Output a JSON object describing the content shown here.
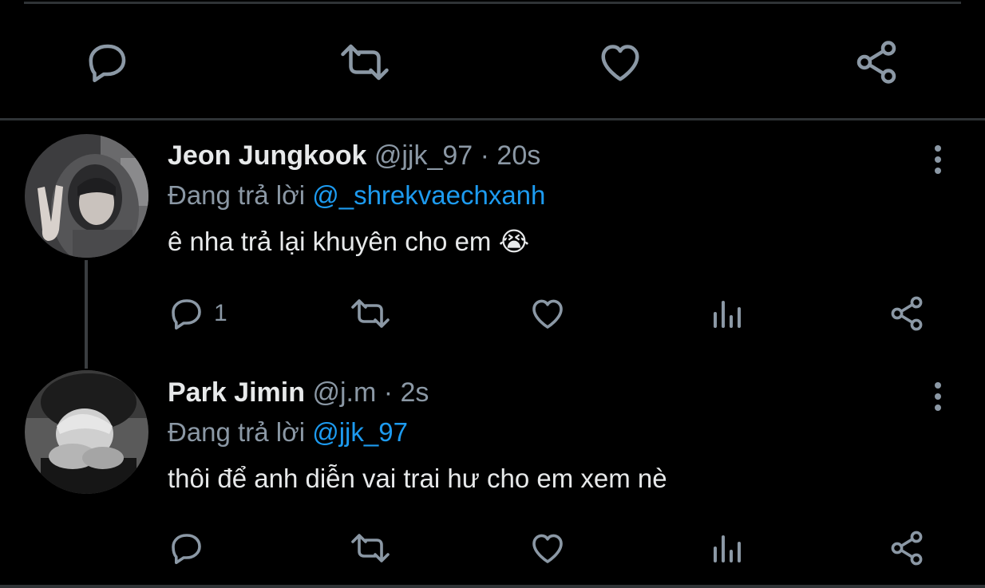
{
  "top_actions": {
    "reply_icon": "reply-icon",
    "retweet_icon": "retweet-icon",
    "like_icon": "like-icon",
    "share_icon": "share-icon"
  },
  "tweets": [
    {
      "name": "Jeon Jungkook",
      "handle": "@jjk_97",
      "separator": "·",
      "time": "20s",
      "replying_prefix": "Đang trả lời",
      "replying_to": "@_shrekvaechxanh",
      "text": "ê nha trả lại khuyên cho em 😭",
      "reply_count": "1"
    },
    {
      "name": "Park Jimin",
      "handle": "@j.m",
      "separator": "·",
      "time": "2s",
      "replying_prefix": "Đang trả lời",
      "replying_to": "@jjk_97",
      "text": "thôi để anh diễn vai trai hư cho em xem nè",
      "reply_count": ""
    }
  ],
  "colors": {
    "background": "#000000",
    "primary_text": "#e7e9ea",
    "secondary_text": "#8b98a5",
    "accent": "#1d9bf0",
    "divider": "#2f3336"
  }
}
